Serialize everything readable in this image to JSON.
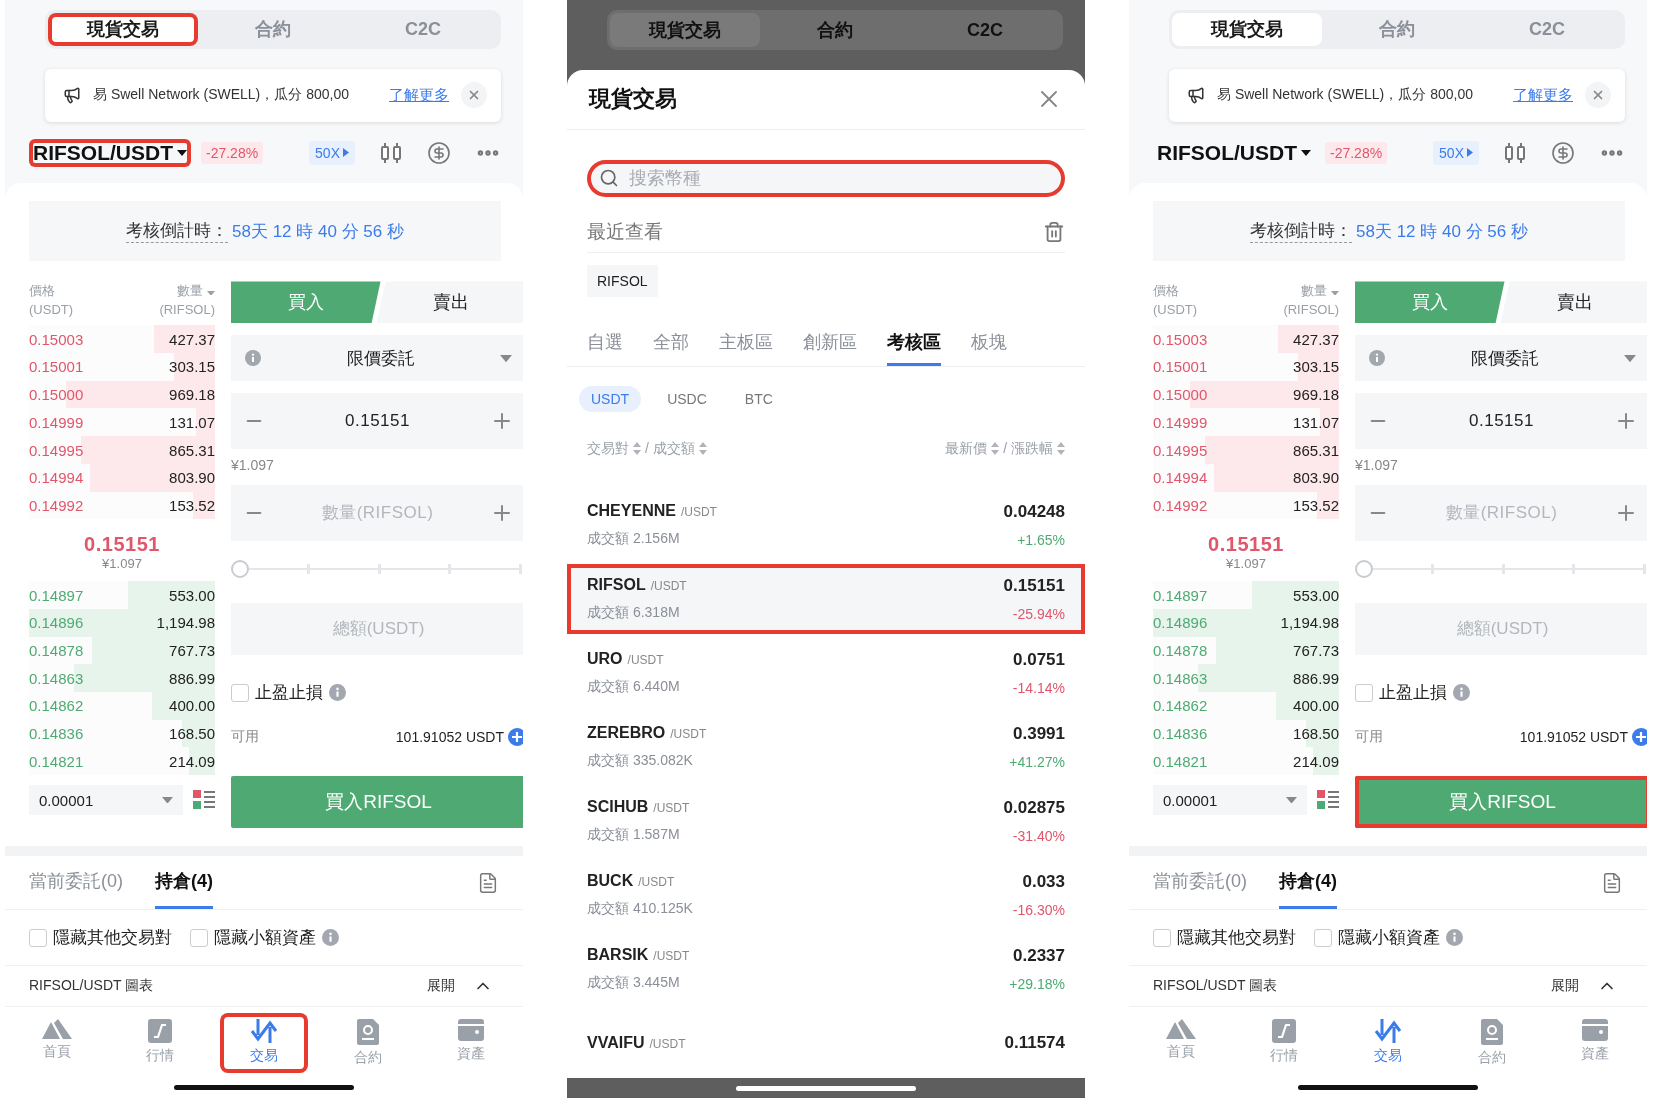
{
  "screens": [
    {
      "kind": "trade",
      "top_tabs": [
        {
          "label": "現貨交易",
          "selected": true,
          "highlighted": true
        },
        {
          "label": "合約",
          "selected": false,
          "highlighted": false
        },
        {
          "label": "C2C",
          "selected": false,
          "highlighted": false
        }
      ],
      "notice": {
        "text": "易 Swell Network (SWELL)，瓜分 800,00",
        "link": "了解更多"
      },
      "pair": {
        "name": "RIFSOL/USDT",
        "change": "-27.28%",
        "highlighted": true
      },
      "leverage": "50X",
      "countdown": {
        "label": "考核倒計時：",
        "value": "58天 12 時 40 分 56 秒"
      },
      "book": {
        "price_header": "價格",
        "price_unit": "(USDT)",
        "qty_header": "數量",
        "qty_unit": "(RIFSOL)",
        "asks": [
          {
            "price": "0.15003",
            "qty": "427.37",
            "level": 0.33
          },
          {
            "price": "0.15001",
            "qty": "303.15",
            "level": 0.22
          },
          {
            "price": "0.15000",
            "qty": "969.18",
            "level": 0.8
          },
          {
            "price": "0.14999",
            "qty": "131.07",
            "level": 0.1
          },
          {
            "price": "0.14995",
            "qty": "865.31",
            "level": 0.72
          },
          {
            "price": "0.14994",
            "qty": "803.90",
            "level": 0.67
          },
          {
            "price": "0.14992",
            "qty": "153.52",
            "level": 0.12
          }
        ],
        "last_price": "0.15151",
        "last_price_fiat": "¥1.097",
        "bids": [
          {
            "price": "0.14897",
            "qty": "553.00",
            "level": 0.47
          },
          {
            "price": "0.14896",
            "qty": "1,194.98",
            "level": 1
          },
          {
            "price": "0.14878",
            "qty": "767.73",
            "level": 0.66
          },
          {
            "price": "0.14863",
            "qty": "886.99",
            "level": 0.76
          },
          {
            "price": "0.14862",
            "qty": "400.00",
            "level": 0.34
          },
          {
            "price": "0.14836",
            "qty": "168.50",
            "level": 0.18
          },
          {
            "price": "0.14821",
            "qty": "214.09",
            "level": 0.14
          }
        ],
        "precision": "0.00001"
      },
      "order": {
        "sides": [
          {
            "label": "買入",
            "selected": true
          },
          {
            "label": "賣出",
            "selected": false
          }
        ],
        "order_type": "限價委託",
        "price": "0.15151",
        "price_fiat": "¥1.097",
        "qty_placeholder": "數量(RIFSOL)",
        "slider": {
          "level": 0
        },
        "total_placeholder": "總額(USDT)",
        "tpsl": {
          "label": "止盈止損",
          "checked": false
        },
        "available_label": "可用",
        "available": "101.91052 USDT",
        "submit": {
          "label": "買入RIFSOL",
          "highlighted": false
        }
      },
      "bottom_tabs": [
        {
          "label": "當前委託(0)",
          "selected": false
        },
        {
          "label": "持倉(4)",
          "selected": true
        }
      ],
      "filters": [
        {
          "label": "隱藏其他交易對",
          "checked": false,
          "info": false
        },
        {
          "label": "隱藏小額資產",
          "checked": false,
          "info": true
        }
      ],
      "chart_bar": {
        "label": "RIFSOL/USDT 圖表",
        "toggle": "展開"
      },
      "nav": [
        {
          "kind": "home",
          "label": "首頁",
          "selected": false,
          "highlighted": false
        },
        {
          "kind": "market",
          "label": "行情",
          "selected": false,
          "highlighted": false
        },
        {
          "kind": "trade",
          "label": "交易",
          "selected": true,
          "highlighted": true
        },
        {
          "kind": "contract",
          "label": "合約",
          "selected": false,
          "highlighted": false
        },
        {
          "kind": "assets",
          "label": "資產",
          "selected": false,
          "highlighted": false
        }
      ]
    },
    {
      "kind": "market_sheet",
      "background_tabs": [
        {
          "label": "現貨交易",
          "selected": true
        },
        {
          "label": "合約",
          "selected": false
        },
        {
          "label": "C2C",
          "selected": false
        }
      ],
      "title": "現貨交易",
      "search": {
        "placeholder": "搜索幣種",
        "highlighted": true
      },
      "recent_label": "最近查看",
      "recent": [
        "RIFSOL"
      ],
      "categories": [
        {
          "label": "自選",
          "selected": false
        },
        {
          "label": "全部",
          "selected": false
        },
        {
          "label": "主板區",
          "selected": false
        },
        {
          "label": "創新區",
          "selected": false
        },
        {
          "label": "考核區",
          "selected": true
        },
        {
          "label": "板塊",
          "selected": false
        }
      ],
      "quotes": [
        {
          "label": "USDT",
          "selected": true
        },
        {
          "label": "USDC",
          "selected": false
        },
        {
          "label": "BTC",
          "selected": false
        }
      ],
      "header": {
        "pair": "交易對",
        "volume": "/ 成交額",
        "price": "最新價",
        "change": "/ 漲跌幅"
      },
      "rows": [
        {
          "symbol": "CHEYENNE",
          "quote": "/USDT",
          "volume": "成交額 2.156M",
          "price": "0.04248",
          "change": "+1.65%",
          "color": "#4eaa72",
          "highlighted": false
        },
        {
          "symbol": "RIFSOL",
          "quote": "/USDT",
          "volume": "成交額 6.318M",
          "price": "0.15151",
          "change": "-25.94%",
          "color": "#e0566b",
          "highlighted": true
        },
        {
          "symbol": "URO",
          "quote": "/USDT",
          "volume": "成交額 6.440M",
          "price": "0.0751",
          "change": "-14.14%",
          "color": "#e0566b",
          "highlighted": false
        },
        {
          "symbol": "ZEREBRO",
          "quote": "/USDT",
          "volume": "成交額 335.082K",
          "price": "0.3991",
          "change": "+41.27%",
          "color": "#4eaa72",
          "highlighted": false
        },
        {
          "symbol": "SCIHUB",
          "quote": "/USDT",
          "volume": "成交額 1.587M",
          "price": "0.02875",
          "change": "-31.40%",
          "color": "#e0566b",
          "highlighted": false
        },
        {
          "symbol": "BUCK",
          "quote": "/USDT",
          "volume": "成交額 410.125K",
          "price": "0.033",
          "change": "-16.30%",
          "color": "#e0566b",
          "highlighted": false
        },
        {
          "symbol": "BARSIK",
          "quote": "/USDT",
          "volume": "成交額 3.445M",
          "price": "0.2337",
          "change": "+29.18%",
          "color": "#4eaa72",
          "highlighted": false
        },
        {
          "symbol": "VVAIFU",
          "quote": "/USDT",
          "price": "0.11574",
          "highlighted": false
        }
      ]
    },
    {
      "kind": "trade",
      "top_tabs": [
        {
          "label": "現貨交易",
          "selected": true,
          "highlighted": false
        },
        {
          "label": "合約",
          "selected": false,
          "highlighted": false
        },
        {
          "label": "C2C",
          "selected": false,
          "highlighted": false
        }
      ],
      "notice": {
        "text": "易 Swell Network (SWELL)，瓜分 800,00",
        "link": "了解更多"
      },
      "pair": {
        "name": "RIFSOL/USDT",
        "change": "-27.28%",
        "highlighted": false
      },
      "leverage": "50X",
      "countdown": {
        "label": "考核倒計時：",
        "value": "58天 12 時 40 分 56 秒"
      },
      "book": {
        "price_header": "價格",
        "price_unit": "(USDT)",
        "qty_header": "數量",
        "qty_unit": "(RIFSOL)",
        "asks": [
          {
            "price": "0.15003",
            "qty": "427.37",
            "level": 0.33
          },
          {
            "price": "0.15001",
            "qty": "303.15",
            "level": 0.22
          },
          {
            "price": "0.15000",
            "qty": "969.18",
            "level": 0.8
          },
          {
            "price": "0.14999",
            "qty": "131.07",
            "level": 0.1
          },
          {
            "price": "0.14995",
            "qty": "865.31",
            "level": 0.72
          },
          {
            "price": "0.14994",
            "qty": "803.90",
            "level": 0.67
          },
          {
            "price": "0.14992",
            "qty": "153.52",
            "level": 0.12
          }
        ],
        "last_price": "0.15151",
        "last_price_fiat": "¥1.097",
        "bids": [
          {
            "price": "0.14897",
            "qty": "553.00",
            "level": 0.47
          },
          {
            "price": "0.14896",
            "qty": "1,194.98",
            "level": 1
          },
          {
            "price": "0.14878",
            "qty": "767.73",
            "level": 0.66
          },
          {
            "price": "0.14863",
            "qty": "886.99",
            "level": 0.76
          },
          {
            "price": "0.14862",
            "qty": "400.00",
            "level": 0.34
          },
          {
            "price": "0.14836",
            "qty": "168.50",
            "level": 0.18
          },
          {
            "price": "0.14821",
            "qty": "214.09",
            "level": 0.14
          }
        ],
        "precision": "0.00001"
      },
      "order": {
        "sides": [
          {
            "label": "買入",
            "selected": true
          },
          {
            "label": "賣出",
            "selected": false
          }
        ],
        "order_type": "限價委託",
        "price": "0.15151",
        "price_fiat": "¥1.097",
        "qty_placeholder": "數量(RIFSOL)",
        "slider": {
          "level": 0
        },
        "total_placeholder": "總額(USDT)",
        "tpsl": {
          "label": "止盈止損",
          "checked": false
        },
        "available_label": "可用",
        "available": "101.91052 USDT",
        "submit": {
          "label": "買入RIFSOL",
          "highlighted": true
        }
      },
      "bottom_tabs": [
        {
          "label": "當前委託(0)",
          "selected": false
        },
        {
          "label": "持倉(4)",
          "selected": true
        }
      ],
      "filters": [
        {
          "label": "隱藏其他交易對",
          "checked": false,
          "info": false
        },
        {
          "label": "隱藏小額資產",
          "checked": false,
          "info": true
        }
      ],
      "chart_bar": {
        "label": "RIFSOL/USDT 圖表",
        "toggle": "展開"
      },
      "nav": [
        {
          "kind": "home",
          "label": "首頁",
          "selected": false,
          "highlighted": false
        },
        {
          "kind": "market",
          "label": "行情",
          "selected": false,
          "highlighted": false
        },
        {
          "kind": "trade",
          "label": "交易",
          "selected": true,
          "highlighted": false
        },
        {
          "kind": "contract",
          "label": "合約",
          "selected": false,
          "highlighted": false
        },
        {
          "kind": "assets",
          "label": "資產",
          "selected": false,
          "highlighted": false
        }
      ]
    }
  ]
}
